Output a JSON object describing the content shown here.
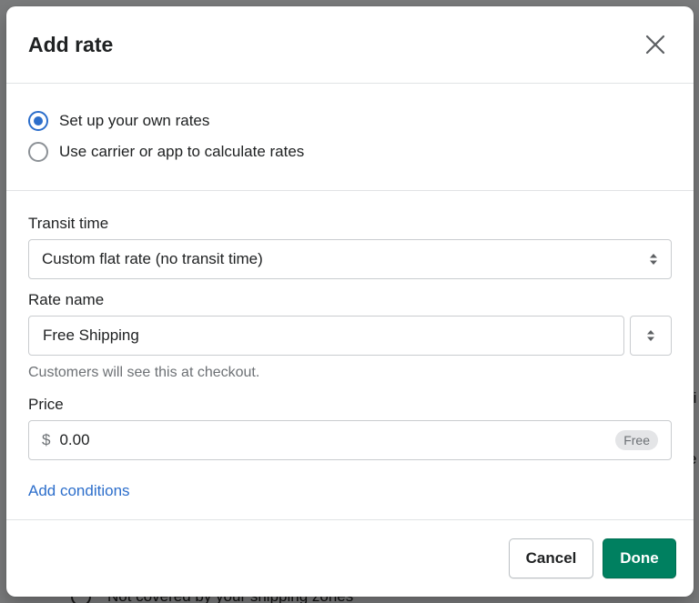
{
  "background": {
    "row_text": "Not covered by your shipping zones",
    "right_text_1": "ri",
    "right_text_2": "e"
  },
  "modal": {
    "title": "Add rate",
    "close_icon": "close-icon"
  },
  "rate_type": {
    "options": [
      {
        "label": "Set up your own rates",
        "checked": true
      },
      {
        "label": "Use carrier or app to calculate rates",
        "checked": false
      }
    ]
  },
  "form": {
    "transit_label": "Transit time",
    "transit_value": "Custom flat rate (no transit time)",
    "rate_name_label": "Rate name",
    "rate_name_value": "Free Shipping",
    "rate_name_help": "Customers will see this at checkout.",
    "price_label": "Price",
    "price_prefix": "$",
    "price_value": "0.00",
    "price_badge": "Free",
    "add_conditions": "Add conditions"
  },
  "footer": {
    "cancel": "Cancel",
    "done": "Done"
  },
  "colors": {
    "accent": "#2c6ecb",
    "primary_button": "#008060"
  }
}
